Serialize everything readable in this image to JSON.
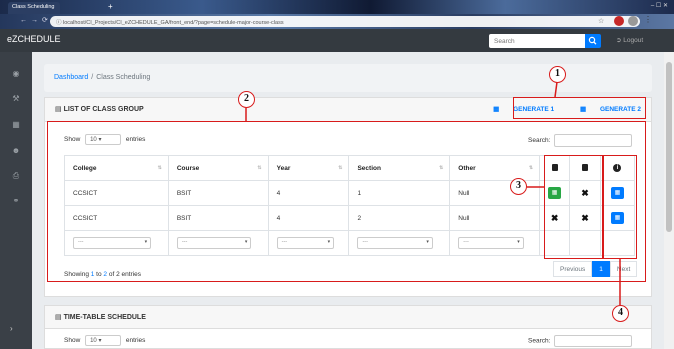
{
  "browser": {
    "tab_title": "Class Scheduling",
    "url": "localhost/CI_Projects/CI_eZCHEDULE_GA/front_end/?page=schedule-major-course-class",
    "new_tab": "+",
    "window_controls": "– ☐ ✕"
  },
  "navbar": {
    "brand": "eZCHEDULE",
    "search_placeholder": "Search",
    "logout_label": "Logout"
  },
  "sidebar": {
    "icons": [
      "dashboard-icon",
      "wrench-icon",
      "calendar-icon",
      "user-icon",
      "printer-icon",
      "link-icon"
    ]
  },
  "breadcrumb": {
    "home": "Dashboard",
    "separator": "/",
    "current": "Class Scheduling"
  },
  "class_group": {
    "title": "LIST OF CLASS GROUP",
    "generate1": "GENERATE 1",
    "generate2": "GENERATE 2",
    "show_label": "Show",
    "entries_value": "10",
    "entries_label": "entries",
    "search_label": "Search:",
    "columns": [
      "College",
      "Course",
      "Year",
      "Section",
      "Other"
    ],
    "rows": [
      {
        "college": "CCSICT",
        "course": "BSIT",
        "year": "4",
        "section": "1",
        "other": "Null"
      },
      {
        "college": "CCSICT",
        "course": "BSIT",
        "year": "4",
        "section": "2",
        "other": "Null"
      }
    ],
    "filter_placeholder": "---",
    "info_prefix": "Showing ",
    "info_start": "1",
    "info_mid": " to ",
    "info_end": "2",
    "info_suffix": " of 2 entries",
    "pager": {
      "previous": "Previous",
      "page": "1",
      "next": "Next"
    }
  },
  "timetable": {
    "title": "TIME-TABLE SCHEDULE",
    "show_label": "Show",
    "entries_value": "10",
    "entries_label": "entries",
    "search_label": "Search:"
  },
  "annotations": [
    "1",
    "2",
    "3",
    "4"
  ],
  "colors": {
    "annotation": "#d81b1b",
    "primary": "#007bff",
    "success": "#28a745",
    "navbar": "#343a40"
  }
}
